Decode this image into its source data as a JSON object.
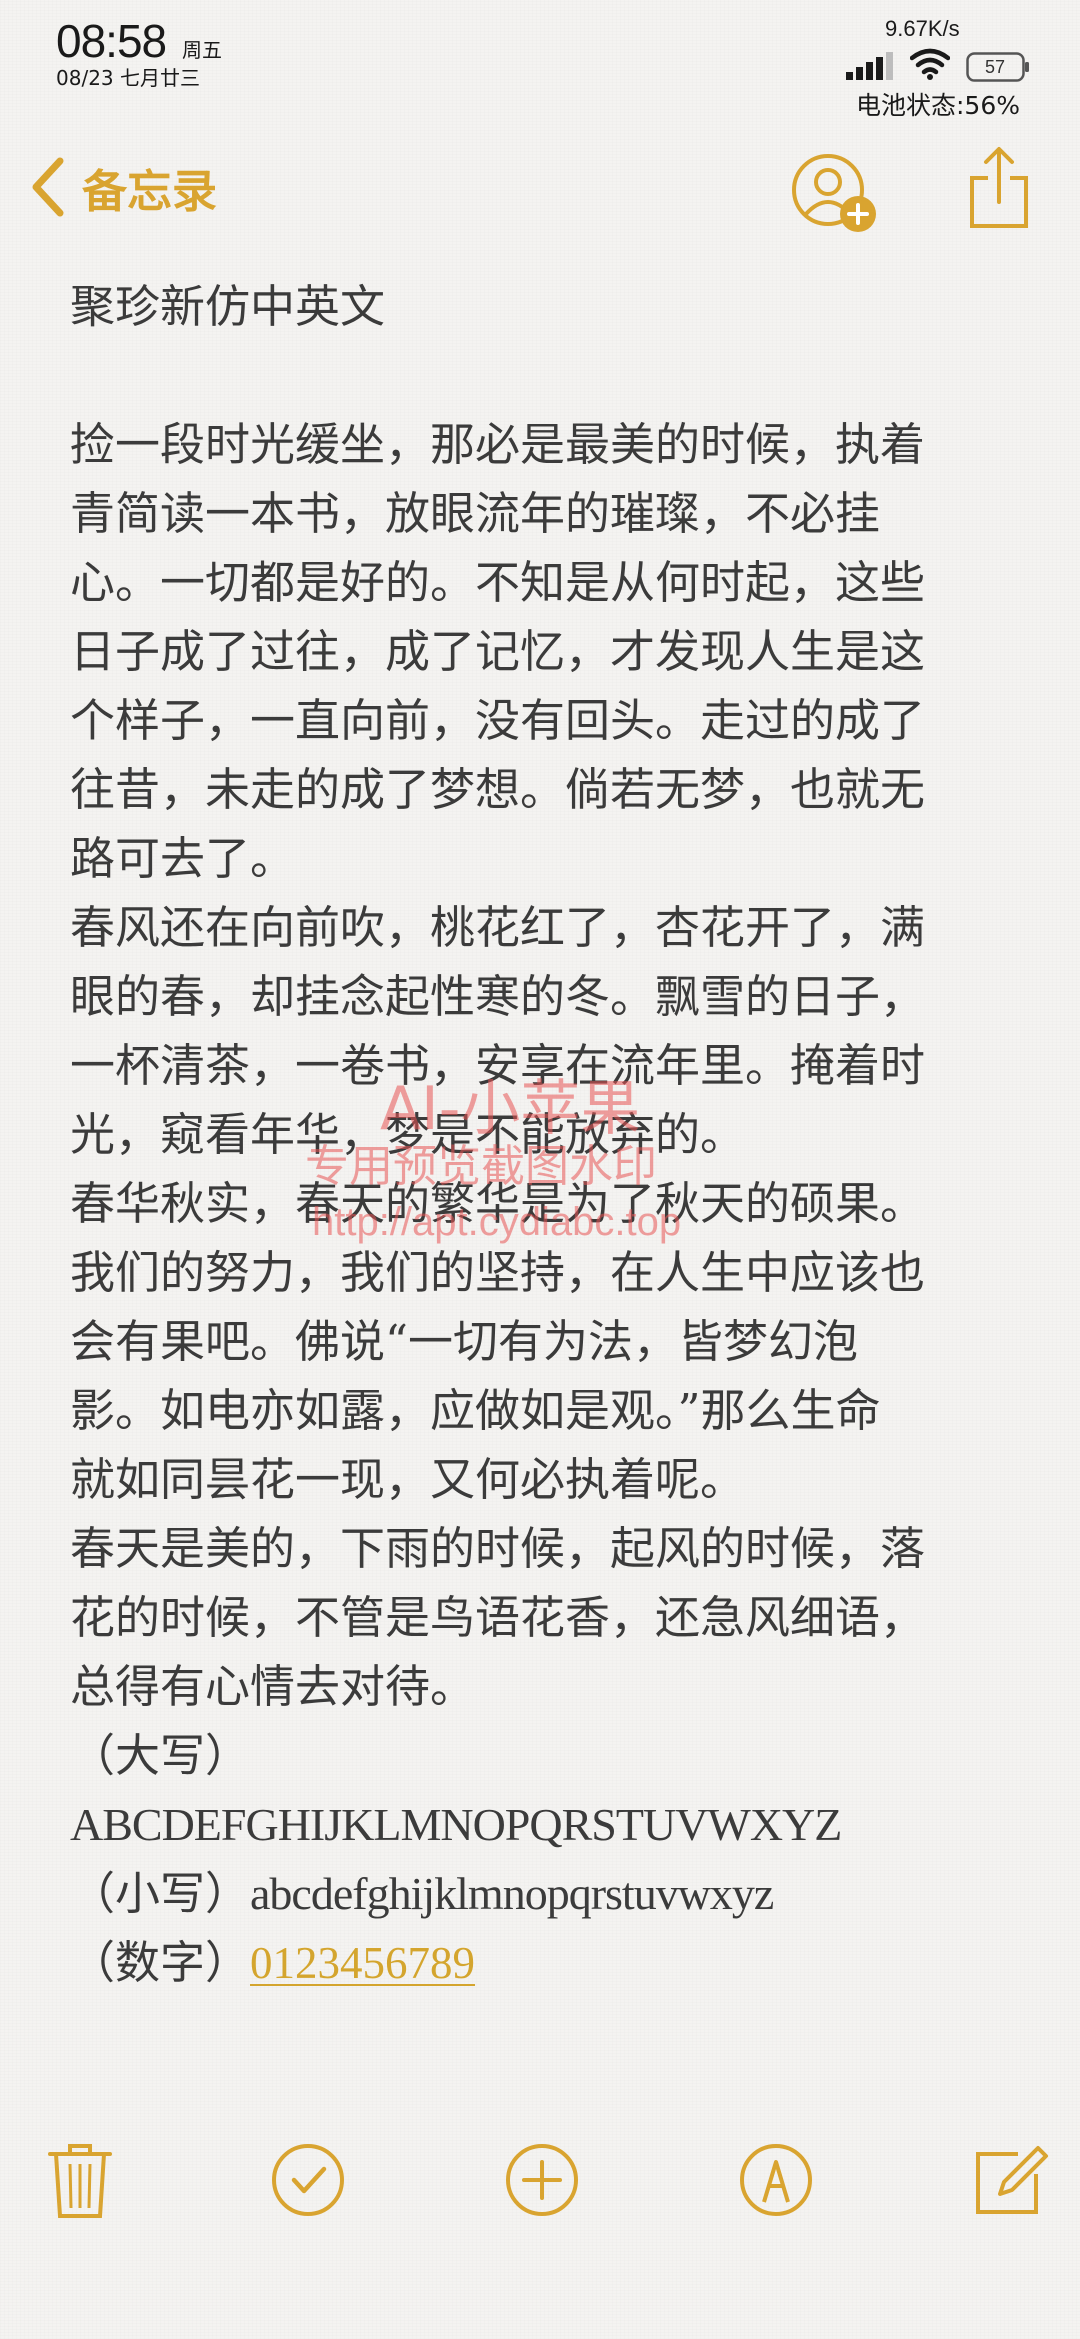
{
  "status_bar": {
    "time": "08:58",
    "weekday": "周五",
    "date": "08/23 七月廿三",
    "net_speed": "9.67K/s",
    "battery_level": "57",
    "battery_status": "电池状态:56%"
  },
  "nav": {
    "back_label": "备忘录",
    "accent_color": "#d9a430"
  },
  "note": {
    "title": "聚珍新仿中英文",
    "paragraphs": [
      [
        "捡一段时光缓坐，那必是最美的时候，执着",
        "青简读一本书，放眼流年的璀璨，不必挂",
        "心。一切都是好的。不知是从何时起，这些",
        "日子成了过往，成了记忆，才发现人生是这",
        "个样子，一直向前，没有回头。走过的成了",
        "往昔，未走的成了梦想。倘若无梦，也就无",
        "路可去了。"
      ],
      [
        "春风还在向前吹，桃花红了，杏花开了，满",
        "眼的春，却挂念起性寒的冬。飘雪的日子，",
        "一杯清茶，一卷书，安享在流年里。掩着时",
        "光，窥看年华，梦是不能放弃的。"
      ],
      [
        "春华秋实，春天的繁华是为了秋天的硕果。",
        "我们的努力，我们的坚持，在人生中应该也",
        "会有果吧。佛说“一切有为法，皆梦幻泡",
        "影。如电亦如露，应做如是观。”那么生命",
        "就如同昙花一现，又何必执着呢。"
      ],
      [
        "春天是美的，下雨的时候，起风的时候，落",
        "花的时候，不管是鸟语花香，还急风细语，",
        "总得有心情去对待。"
      ]
    ],
    "uppercase_label": "（大写）",
    "uppercase": "ABCDEFGHIJKLMNOPQRSTUVWXYZ",
    "lowercase_label": "（小写）",
    "lowercase": "abcdefghijklmnopqrstuvwxyz",
    "digits_label": "（数字）",
    "digits": "0123456789"
  },
  "watermark": {
    "line1": "AI-小苹果",
    "line2": "专用预览截图水印",
    "line3": "http://apt.cydiabc.top"
  },
  "toolbar": {
    "icons": [
      "trash-icon",
      "checklist-icon",
      "add-icon",
      "markup-icon",
      "compose-icon"
    ]
  }
}
